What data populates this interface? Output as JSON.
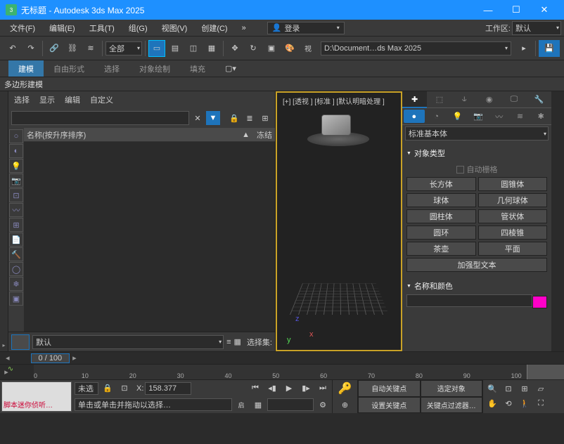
{
  "titlebar": {
    "title": "无标题 - Autodesk 3ds Max 2025"
  },
  "menu": {
    "file": "文件(F)",
    "edit": "编辑(E)",
    "tools": "工具(T)",
    "group": "组(G)",
    "view": "视图(V)",
    "create": "创建(C)",
    "more": "»",
    "login": "登录",
    "workspace_label": "工作区:",
    "workspace_value": "默认"
  },
  "toolbar": {
    "scope": "全部",
    "path": "D:\\Document…ds Max 2025",
    "view_label": "视"
  },
  "ribbon": {
    "modeling": "建模",
    "freeform": "自由形式",
    "select": "选择",
    "object_paint": "对象绘制",
    "fill": "填充",
    "sub": "多边形建模"
  },
  "scene": {
    "tab_select": "选择",
    "tab_display": "显示",
    "tab_edit": "编辑",
    "tab_custom": "自定义",
    "col_name": "名称(按升序排序)",
    "col_frozen": "冻结",
    "layer": "默认",
    "sel_set_label": "选择集:"
  },
  "viewport": {
    "label": "[+] [透视 ] [标准 ] [默认明暗处理 ]"
  },
  "cmd": {
    "category": "标准基本体",
    "section_objtype": "对象类型",
    "autogrid": "自动栅格",
    "btns": {
      "box": "长方体",
      "cone": "圆锥体",
      "sphere": "球体",
      "geosphere": "几何球体",
      "cylinder": "圆柱体",
      "tube": "管状体",
      "torus": "圆环",
      "pyramid": "四棱锥",
      "teapot": "茶壶",
      "plane": "平面",
      "textplus": "加强型文本"
    },
    "section_name_color": "名称和颜色"
  },
  "time": {
    "frame": "0 / 100",
    "ticks": [
      "0",
      "10",
      "20",
      "30",
      "40",
      "50",
      "60",
      "70",
      "80",
      "90",
      "100"
    ]
  },
  "status": {
    "listener": "脚本迷你侦听…",
    "unsel": "未选",
    "coord_x_label": "X:",
    "coord_x": "158.377",
    "prompt": "单击或单击并拖动以选择…",
    "autokey": "自动关键点",
    "selobj": "选定对象",
    "setkey": "设置关键点",
    "keyfilter": "关键点过滤器…",
    "lock": "启"
  }
}
